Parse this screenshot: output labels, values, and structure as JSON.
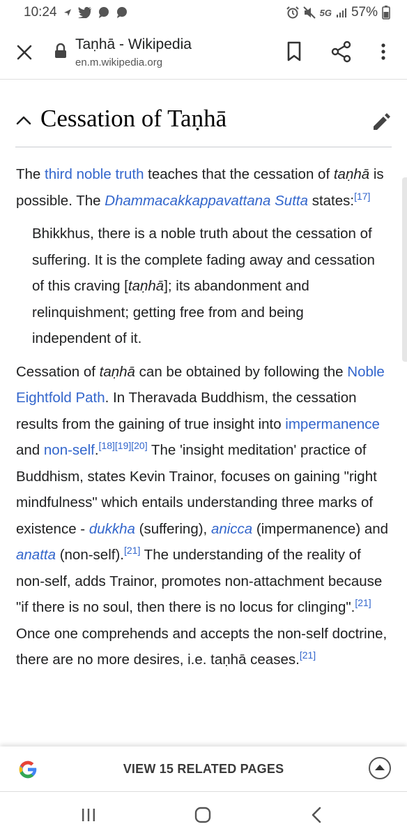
{
  "status_bar": {
    "time": "10:24",
    "network": "5G",
    "battery": "57%",
    "icons": [
      "nav-arrow-icon",
      "twitter-icon",
      "chat-icon",
      "chat-icon",
      "alarm-icon",
      "mute-icon",
      "signal-icon",
      "battery-icon"
    ]
  },
  "browser": {
    "page_title": "Taṇhā - Wikipedia",
    "url": "en.m.wikipedia.org"
  },
  "section": {
    "title": "Cessation of Taṇhā"
  },
  "article": {
    "p1": {
      "t1": "The ",
      "link1": "third noble truth",
      "t2": " teaches that the cessation of ",
      "i1": "taṇhā",
      "t3": " is possible. The ",
      "link2": "Dhammacakkappavattana Sutta",
      "t4": " states:",
      "ref": "[17]"
    },
    "quote": {
      "t1": "Bhikkhus, there is a noble truth about the cessation of suffering. It is the complete fading away and cessation of this craving [",
      "i1": "taṇhā",
      "t2": "]; its abandonment and relinquishment; getting free from and being independent of it."
    },
    "p2": {
      "t1": "Cessation of ",
      "i1": "taṇhā",
      "t2": " can be obtained by following the ",
      "link1": "Noble Eightfold Path",
      "t3": ". In Theravada Buddhism, the cessation results from the gaining of true insight into ",
      "link2": "impermanence",
      "t4": " and ",
      "link3": "non-self",
      "t5": ".",
      "ref1": "[18][19][20]",
      "t6": " The 'insight meditation' practice of Buddhism, states Kevin Trainor, focuses on gaining \"right mindfulness\" which entails understanding three marks of existence - ",
      "link4": "dukkha",
      "t7": " (suffering), ",
      "link5": "anicca",
      "t8": " (impermanence) and ",
      "link6": "anatta",
      "t9": " (non-self).",
      "ref2": "[21]",
      "t10": " The understanding of the reality of non-self, adds Trainor, promotes non-attachment because \"if there is no soul, then there is no locus for clinging\".",
      "ref3": "[21]",
      "t11": " Once one comprehends and accepts the non-self doctrine, there are no more desires, i.e. taṇhā ceases.",
      "ref4": "[21]"
    }
  },
  "related": {
    "label": "VIEW 15 RELATED PAGES"
  },
  "colors": {
    "link": "#3366cc",
    "text": "#202122",
    "google_blue": "#4285F4",
    "google_red": "#EA4335",
    "google_yellow": "#FBBC05",
    "google_green": "#34A853"
  }
}
